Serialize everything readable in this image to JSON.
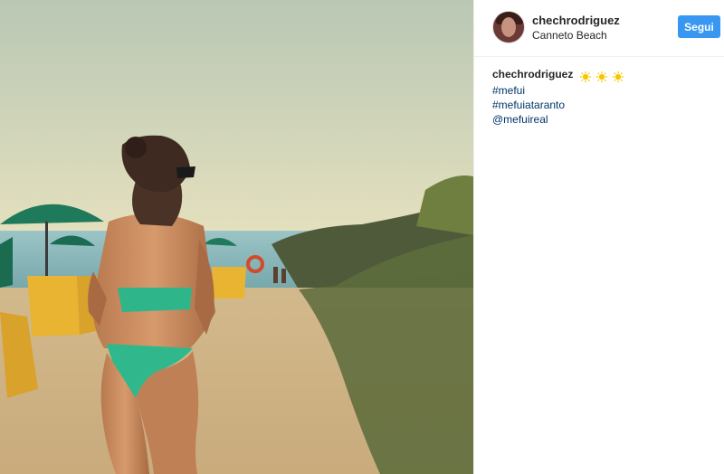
{
  "post": {
    "username": "chechrodriguez",
    "location": "Canneto Beach",
    "follow_label": "Segui"
  },
  "caption": {
    "username": "chechrodriguez",
    "emoji": [
      "sun-icon",
      "sun-icon",
      "sun-icon"
    ],
    "tags": [
      "#mefui",
      "#mefuiataranto",
      "@mefuireal"
    ]
  },
  "colors": {
    "accent": "#3897f0",
    "link": "#003569",
    "text": "#262626"
  }
}
